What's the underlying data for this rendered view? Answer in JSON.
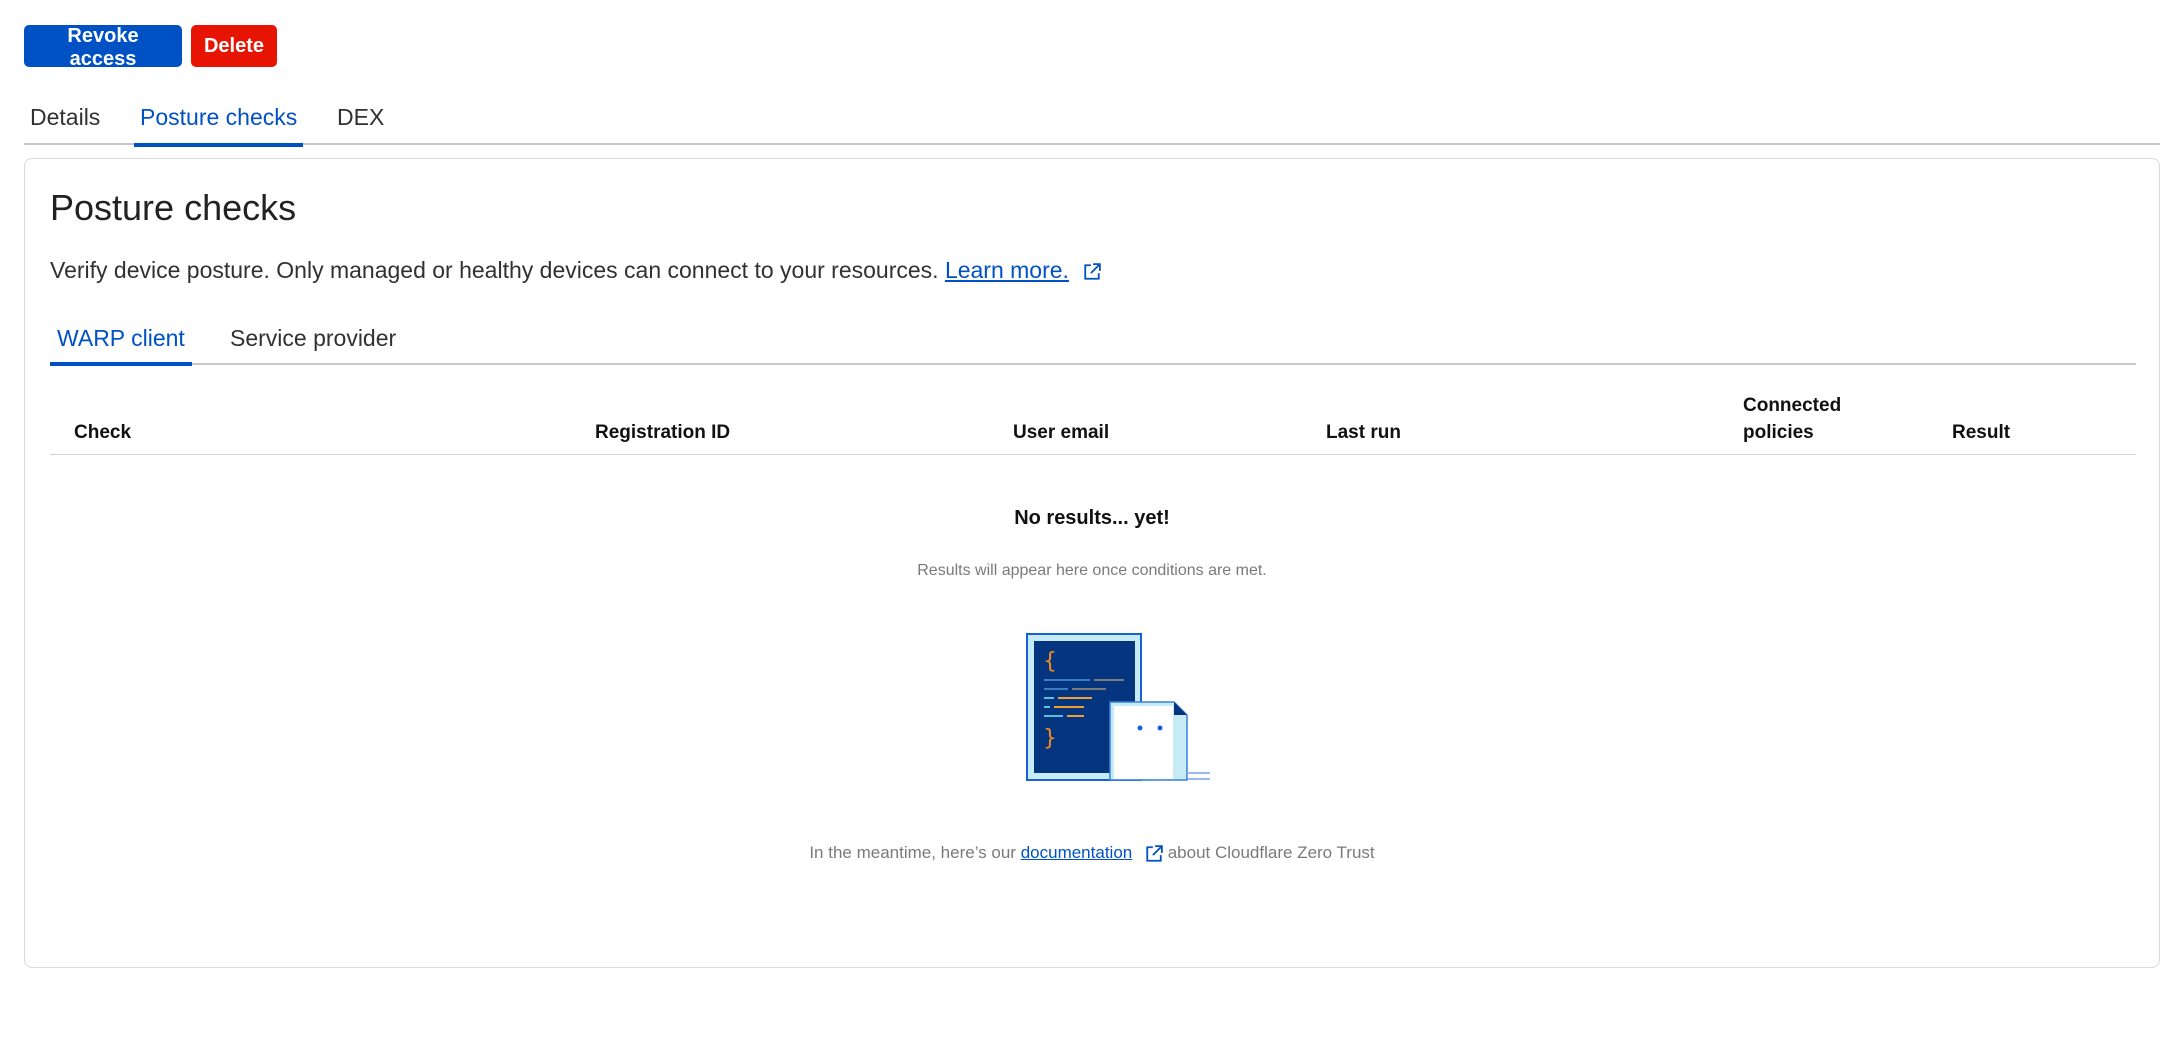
{
  "actions": {
    "revoke": "Revoke access",
    "delete": "Delete"
  },
  "tabs": [
    "Details",
    "Posture checks",
    "DEX"
  ],
  "panel": {
    "title": "Posture checks",
    "description": "Verify device posture. Only managed or healthy devices can connect to your resources.",
    "learn_more": "Learn more.",
    "subtabs": [
      "WARP client",
      "Service provider"
    ],
    "columns": [
      "Check",
      "Registration ID",
      "User email",
      "Last run",
      "Connected policies",
      "Result"
    ],
    "empty": {
      "title": "No results... yet!",
      "subtitle": "Results will appear here once conditions are met.",
      "footer_prefix": "In the meantime, here’s our",
      "footer_link": "documentation",
      "footer_suffix": "about Cloudflare Zero Trust"
    }
  },
  "colors": {
    "primary": "#0051c3",
    "danger": "#e81403"
  }
}
